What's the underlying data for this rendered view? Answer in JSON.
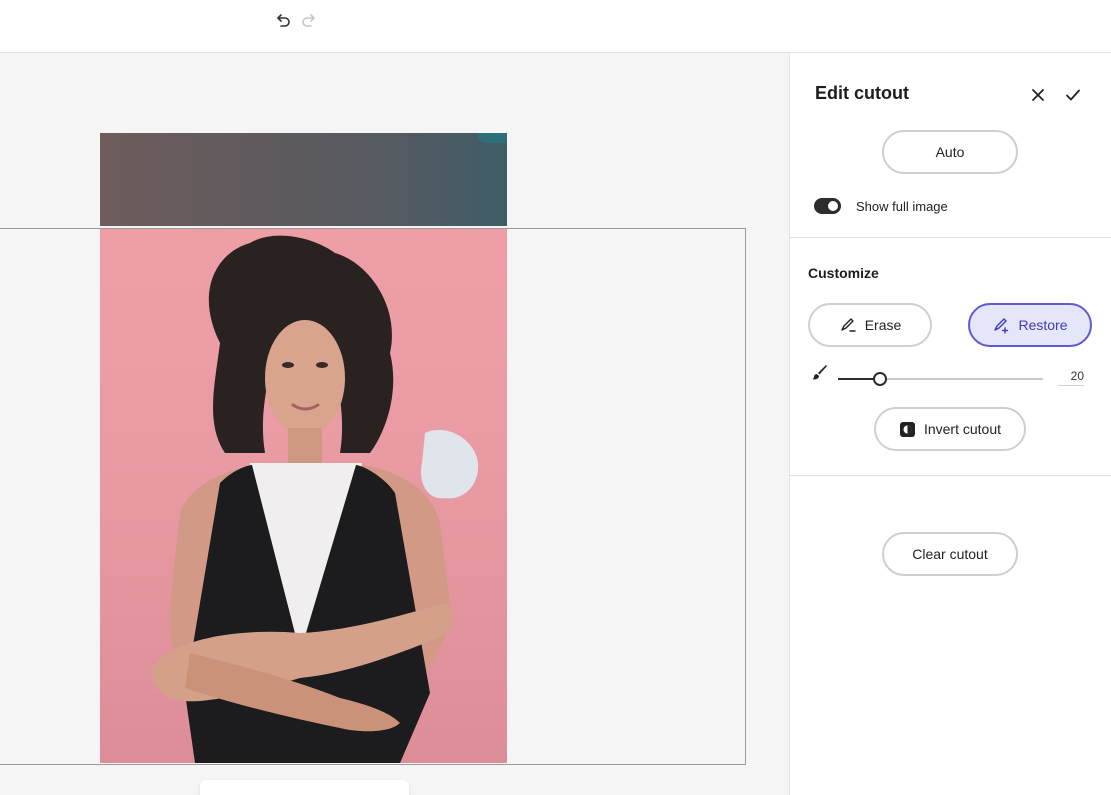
{
  "toolbar": {
    "undo_icon": "undo-icon",
    "redo_icon": "redo-icon"
  },
  "panel": {
    "title": "Edit cutout",
    "close_icon": "close-icon",
    "confirm_icon": "checkmark-icon",
    "auto_label": "Auto",
    "show_full_image_label": "Show full image",
    "show_full_image_on": true,
    "customize_title": "Customize",
    "erase_label": "Erase",
    "restore_label": "Restore",
    "brush_size_value": "20",
    "brush_size_fraction": 0.2,
    "invert_label": "Invert cutout",
    "clear_label": "Clear cutout"
  },
  "colors": {
    "accent": "#5b5bd6",
    "accent_bg": "#e6e6fa",
    "photo_background": "#ee9fa6"
  }
}
